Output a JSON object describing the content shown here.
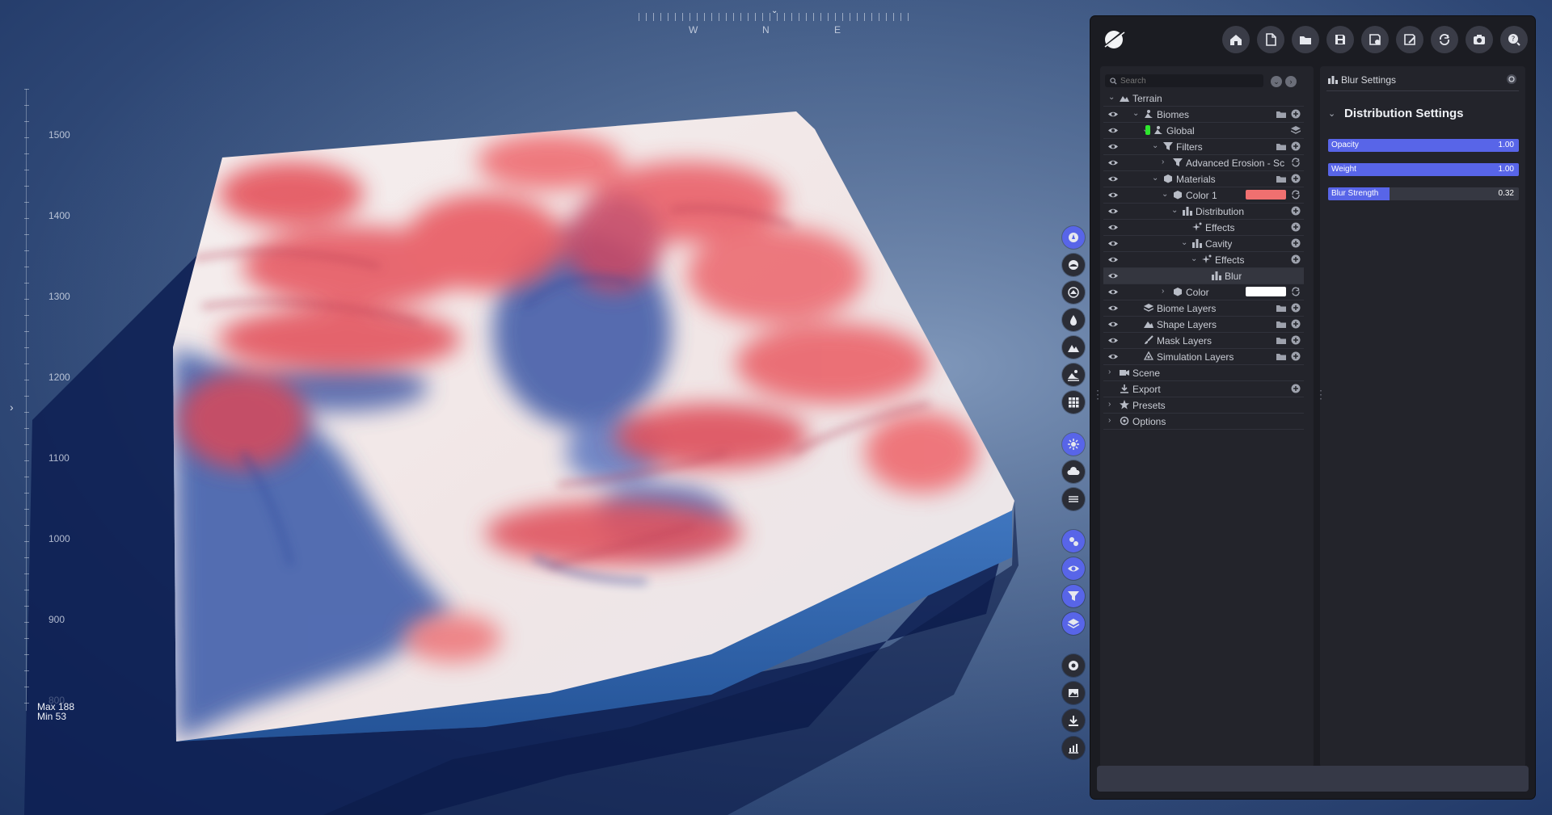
{
  "compass": {
    "pointer": "⌄",
    "w": "W",
    "n": "N",
    "e": "E"
  },
  "altitude": {
    "labels": [
      "1500",
      "1400",
      "1300",
      "1200",
      "1100",
      "1000",
      "900",
      "800"
    ],
    "max": "Max 188",
    "min": "Min 53"
  },
  "left_toggle": "›",
  "vertical_toolbar": [
    {
      "icon": "cursor-icon",
      "active": true
    },
    {
      "icon": "sculpt-icon",
      "active": false
    },
    {
      "icon": "erosion-icon",
      "active": false
    },
    {
      "icon": "water-drop-icon",
      "active": false
    },
    {
      "icon": "mountain-icon",
      "active": false
    },
    {
      "icon": "landscape-icon",
      "active": false
    },
    {
      "icon": "grid-icon",
      "active": false
    },
    {
      "icon": "sun-icon",
      "active": true
    },
    {
      "icon": "cloud-icon",
      "active": false
    },
    {
      "icon": "fog-icon",
      "active": false
    },
    {
      "icon": "render-settings-icon",
      "active": true
    },
    {
      "icon": "eye-icon",
      "active": true
    },
    {
      "icon": "filter-icon",
      "active": true
    },
    {
      "icon": "layers-icon",
      "active": true
    },
    {
      "icon": "record-icon",
      "active": false
    },
    {
      "icon": "image-icon",
      "active": false
    },
    {
      "icon": "download-icon",
      "active": false
    },
    {
      "icon": "chart-icon",
      "active": false
    }
  ],
  "toolbar": [
    "home-icon",
    "new-file-icon",
    "open-folder-icon",
    "save-icon",
    "save-settings-icon",
    "save-as-icon",
    "refresh-icon",
    "camera-icon",
    "help-icon"
  ],
  "tree": {
    "search_placeholder": "Search",
    "rows": [
      {
        "label": "Terrain",
        "depth": 0,
        "chevron": "⌄",
        "eye": false,
        "icon": "terrain-icon",
        "actions": []
      },
      {
        "label": "Biomes",
        "depth": 1,
        "chevron": "⌄",
        "eye": true,
        "icon": "biome-icon",
        "actions": [
          "folder-icon",
          "add-icon"
        ]
      },
      {
        "label": "Global",
        "depth": 2,
        "chevron": "⌄",
        "eye": true,
        "icon": "biome-icon",
        "badge": "#2ee62e",
        "actions": [
          "layers-icon"
        ]
      },
      {
        "label": "Filters",
        "depth": 3,
        "chevron": "⌄",
        "eye": true,
        "icon": "filter-icon",
        "actions": [
          "folder-icon",
          "add-icon"
        ]
      },
      {
        "label": "Advanced Erosion - Sc",
        "depth": 4,
        "chevron": "›",
        "eye": true,
        "icon": "filter-icon",
        "actions": [
          "sync-icon"
        ]
      },
      {
        "label": "Materials",
        "depth": 3,
        "chevron": "⌄",
        "eye": true,
        "icon": "cube-icon",
        "actions": [
          "folder-icon",
          "add-icon"
        ]
      },
      {
        "label": "Color 1",
        "depth": 4,
        "chevron": "⌄",
        "eye": true,
        "icon": "cube-icon",
        "swatch": "#f07070",
        "actions": [
          "sync-icon"
        ]
      },
      {
        "label": "Distribution",
        "depth": 5,
        "chevron": "⌄",
        "eye": true,
        "icon": "distribution-icon",
        "actions": [
          "add-icon"
        ]
      },
      {
        "label": "Effects",
        "depth": 6,
        "chevron": "",
        "eye": true,
        "icon": "effects-icon",
        "actions": [
          "add-icon"
        ]
      },
      {
        "label": "Cavity",
        "depth": 6,
        "chevron": "⌄",
        "eye": true,
        "icon": "distribution-icon",
        "actions": [
          "add-icon"
        ]
      },
      {
        "label": "Effects",
        "depth": 7,
        "chevron": "⌄",
        "eye": true,
        "icon": "effects-icon",
        "actions": [
          "add-icon"
        ]
      },
      {
        "label": "Blur",
        "depth": 8,
        "chevron": "",
        "eye": true,
        "icon": "distribution-icon",
        "selected": true,
        "actions": []
      },
      {
        "label": "Color",
        "depth": 4,
        "chevron": "›",
        "eye": true,
        "icon": "cube-icon",
        "swatch": "#ffffff",
        "actions": [
          "sync-icon"
        ]
      },
      {
        "label": "Biome Layers",
        "depth": 1,
        "chevron": "",
        "eye": true,
        "icon": "stack-icon",
        "actions": [
          "folder-icon",
          "add-icon"
        ]
      },
      {
        "label": "Shape Layers",
        "depth": 1,
        "chevron": "",
        "eye": true,
        "icon": "mountain-icon",
        "actions": [
          "folder-icon",
          "add-icon"
        ]
      },
      {
        "label": "Mask Layers",
        "depth": 1,
        "chevron": "",
        "eye": true,
        "icon": "brush-icon",
        "actions": [
          "folder-icon",
          "add-icon"
        ]
      },
      {
        "label": "Simulation Layers",
        "depth": 1,
        "chevron": "",
        "eye": true,
        "icon": "simulation-icon",
        "actions": [
          "folder-icon",
          "add-icon"
        ]
      },
      {
        "label": "Scene",
        "depth": 0,
        "chevron": "›",
        "eye": false,
        "icon": "video-icon",
        "actions": []
      },
      {
        "label": "Export",
        "depth": 0,
        "chevron": "",
        "eye": false,
        "icon": "download-icon",
        "actions": [
          "add-icon"
        ]
      },
      {
        "label": "Presets",
        "depth": 0,
        "chevron": "›",
        "eye": false,
        "icon": "star-icon",
        "actions": []
      },
      {
        "label": "Options",
        "depth": 0,
        "chevron": "›",
        "eye": false,
        "icon": "gear-icon",
        "actions": []
      }
    ]
  },
  "settings": {
    "title": "Blur Settings",
    "section_title": "Distribution Settings",
    "sliders": [
      {
        "name": "Opacity",
        "value": "1.00",
        "fraction": 1.0
      },
      {
        "name": "Weight",
        "value": "1.00",
        "fraction": 1.0
      },
      {
        "name": "Blur Strength",
        "value": "0.32",
        "fraction": 0.32
      }
    ]
  },
  "colors": {
    "accent": "#5865e8",
    "panel": "#1b1c22",
    "terrain_red": "#e8545a",
    "terrain_snow": "#f3eeee"
  }
}
